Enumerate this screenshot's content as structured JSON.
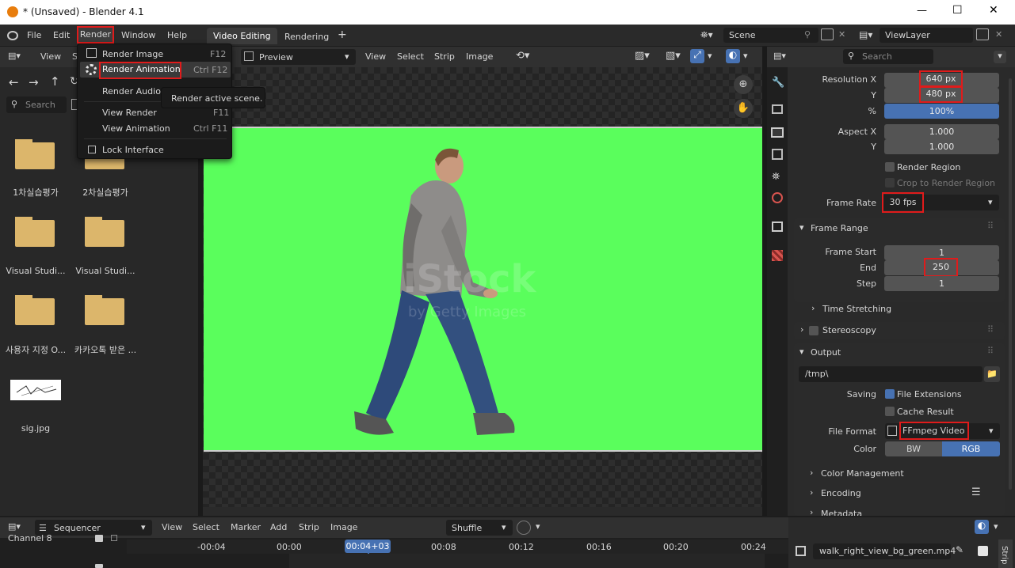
{
  "window": {
    "title": "* (Unsaved) - Blender 4.1",
    "minimize": "—",
    "maximize": "☐",
    "close": "✕"
  },
  "topbar": {
    "menus": [
      "File",
      "Edit",
      "Render",
      "Window",
      "Help"
    ],
    "workspaces": [
      "Video Editing",
      "Rendering"
    ],
    "add_tab": "+",
    "scene": "Scene",
    "view_layer": "ViewLayer"
  },
  "render_menu": {
    "items": [
      {
        "label": "Render Image",
        "shortcut": "F12"
      },
      {
        "label": "Render Animation",
        "shortcut": "Ctrl F12"
      },
      {
        "label": "Render Audio..",
        "shortcut": ""
      },
      {
        "label": "View Render",
        "shortcut": "F11"
      },
      {
        "label": "View Animation",
        "shortcut": "Ctrl F11"
      },
      {
        "label": "Lock Interface",
        "shortcut": ""
      }
    ],
    "tooltip": "Render active scene."
  },
  "file_browser": {
    "header_view": "View",
    "header_s": "S",
    "search_placeholder": "Search",
    "items": [
      {
        "name": "1차실습평가",
        "type": "folder"
      },
      {
        "name": "2차실습평가",
        "type": "folder"
      },
      {
        "name": "Visual Studi...",
        "type": "folder"
      },
      {
        "name": "Visual Studi...",
        "type": "folder"
      },
      {
        "name": "사용자 지정 O...",
        "type": "folder"
      },
      {
        "name": "카카오톡 받은 ...",
        "type": "folder"
      },
      {
        "name": "sig.jpg",
        "type": "image"
      }
    ]
  },
  "preview": {
    "mode": "Preview",
    "menus": [
      "View",
      "Select",
      "Strip",
      "Image"
    ],
    "watermark": "iStock",
    "watermark_sub": "by Getty Images"
  },
  "properties": {
    "search_placeholder": "Search",
    "format": [
      {
        "label": "Resolution X",
        "value": "640 px"
      },
      {
        "label": "Y",
        "value": "480 px"
      },
      {
        "label": "%",
        "value": "100%"
      },
      {
        "label": "Aspect X",
        "value": "1.000"
      },
      {
        "label": "Y",
        "value": "1.000"
      }
    ],
    "render_region": "Render Region",
    "crop_region": "Crop to Render Region",
    "frame_rate_label": "Frame Rate",
    "frame_rate": "30 fps",
    "frame_range_title": "Frame Range",
    "frame_range": [
      {
        "label": "Frame Start",
        "value": "1"
      },
      {
        "label": "End",
        "value": "250"
      },
      {
        "label": "Step",
        "value": "1"
      }
    ],
    "time_stretching": "Time Stretching",
    "stereoscopy": "Stereoscopy",
    "output_title": "Output",
    "output_path": "/tmp\\",
    "saving_label": "Saving",
    "file_extensions": "File Extensions",
    "cache_result": "Cache Result",
    "file_format_label": "File Format",
    "file_format": "FFmpeg Video",
    "color_label": "Color",
    "color_bw": "BW",
    "color_rgb": "RGB",
    "color_management": "Color Management",
    "encoding": "Encoding",
    "metadata": "Metadata"
  },
  "sequencer": {
    "editor": "Sequencer",
    "menus": [
      "View",
      "Select",
      "Marker",
      "Add",
      "Strip",
      "Image"
    ],
    "snap": "Shuffle",
    "channel": "Channel 8",
    "times": [
      "-00:04",
      "00:00",
      "00:04+03",
      "00:08",
      "00:12",
      "00:16",
      "00:20",
      "00:24"
    ],
    "strip_name": "walk_right_view_bg_green.mp4",
    "strip_tab": "Strip"
  },
  "colors": {
    "accent": "#4772b3",
    "highlight": "#e01b1b",
    "green_screen": "#5afe5c"
  }
}
